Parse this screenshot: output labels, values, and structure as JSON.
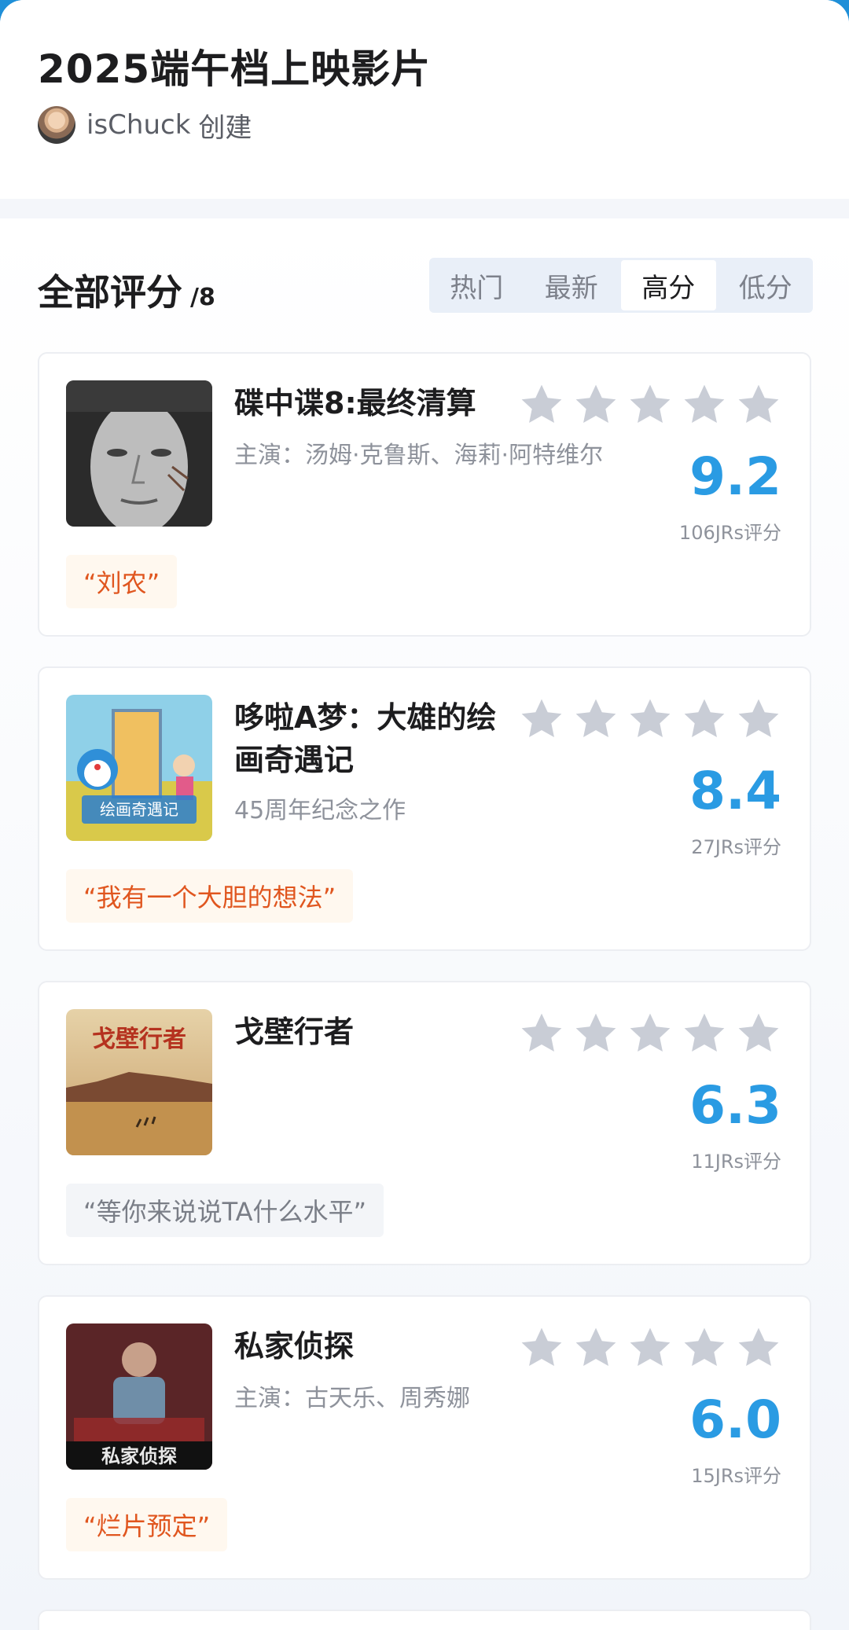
{
  "header": {
    "title": "2025端午档上映影片",
    "creator": "isChuck",
    "creator_suffix": "创建"
  },
  "section": {
    "title": "全部评分",
    "count": "/8",
    "tabs": [
      "热门",
      "最新",
      "高分",
      "低分"
    ],
    "active_tab": "高分"
  },
  "movies": [
    {
      "title": "碟中谍8:最终清算",
      "subtitle": "主演：汤姆·克鲁斯、海莉·阿特维尔",
      "score": "9.2",
      "rating_count": "106JRs评分",
      "quote": "“刘农”",
      "quote_style": "warm",
      "poster": "portrait-poster"
    },
    {
      "title": "哆啦A梦：大雄的绘画奇遇记",
      "subtitle": "45周年纪念之作",
      "score": "8.4",
      "rating_count": "27JRs评分",
      "quote": "“我有一个大胆的想法”",
      "quote_style": "warm",
      "poster": "cartoon-poster",
      "poster_text": "绘画奇遇记"
    },
    {
      "title": "戈壁行者",
      "subtitle": "",
      "score": "6.3",
      "rating_count": "11JRs评分",
      "quote": "“等你来说说TA什么水平”",
      "quote_style": "cool",
      "poster": "desert-poster",
      "poster_text": "戈壁行者"
    },
    {
      "title": "私家侦探",
      "subtitle": "主演：古天乐、周秀娜",
      "score": "6.0",
      "rating_count": "15JRs评分",
      "quote": "“烂片预定”",
      "quote_style": "warm",
      "poster": "detective-poster",
      "poster_text": "私家侦探"
    }
  ],
  "colors": {
    "accent": "#2a9be3",
    "quote_warm": "#e0561f",
    "star": "#c9cdd6"
  }
}
